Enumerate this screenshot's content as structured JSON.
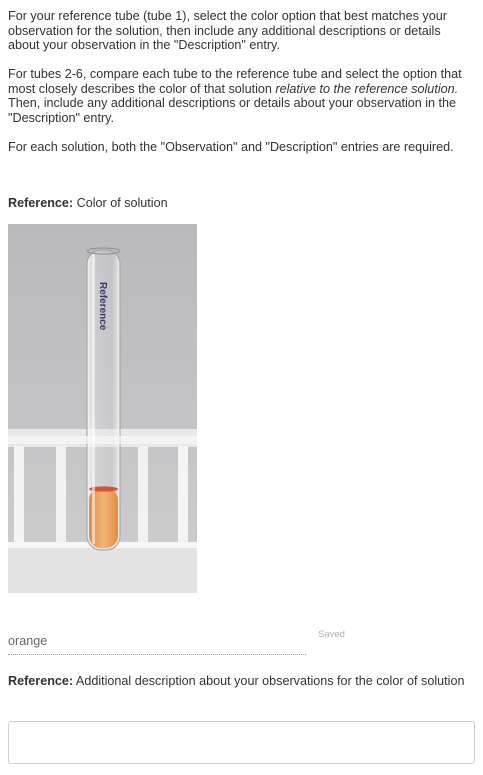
{
  "instructions": {
    "p1": "For your reference tube (tube 1), select the color option that best matches your observation for the solution, then include any additional descriptions or details about your observation in the \"Description\" entry.",
    "p2_start": "For tubes 2-6, compare each tube to the reference tube and select the option that most closely describes the color of that solution ",
    "p2_italic": "relative to the reference solution.",
    "p2_end": " Then, include any additional descriptions or details about your observation in the \"Description\" entry.",
    "p3": "For each solution, both the \"Observation\" and \"Description\" entries are required."
  },
  "observation": {
    "label_bold": "Reference:",
    "label_rest": " Color of solution",
    "photo_tube_text": "Reference",
    "value": "orange",
    "status": "Saved"
  },
  "description": {
    "label_bold": "Reference:",
    "label_rest": " Additional description about your observations for the color of solution",
    "value": ""
  },
  "colors": {
    "text": "#333333",
    "solution": "#e9a15e",
    "meniscus": "#d9532f",
    "rack": "#f2f2f2"
  }
}
